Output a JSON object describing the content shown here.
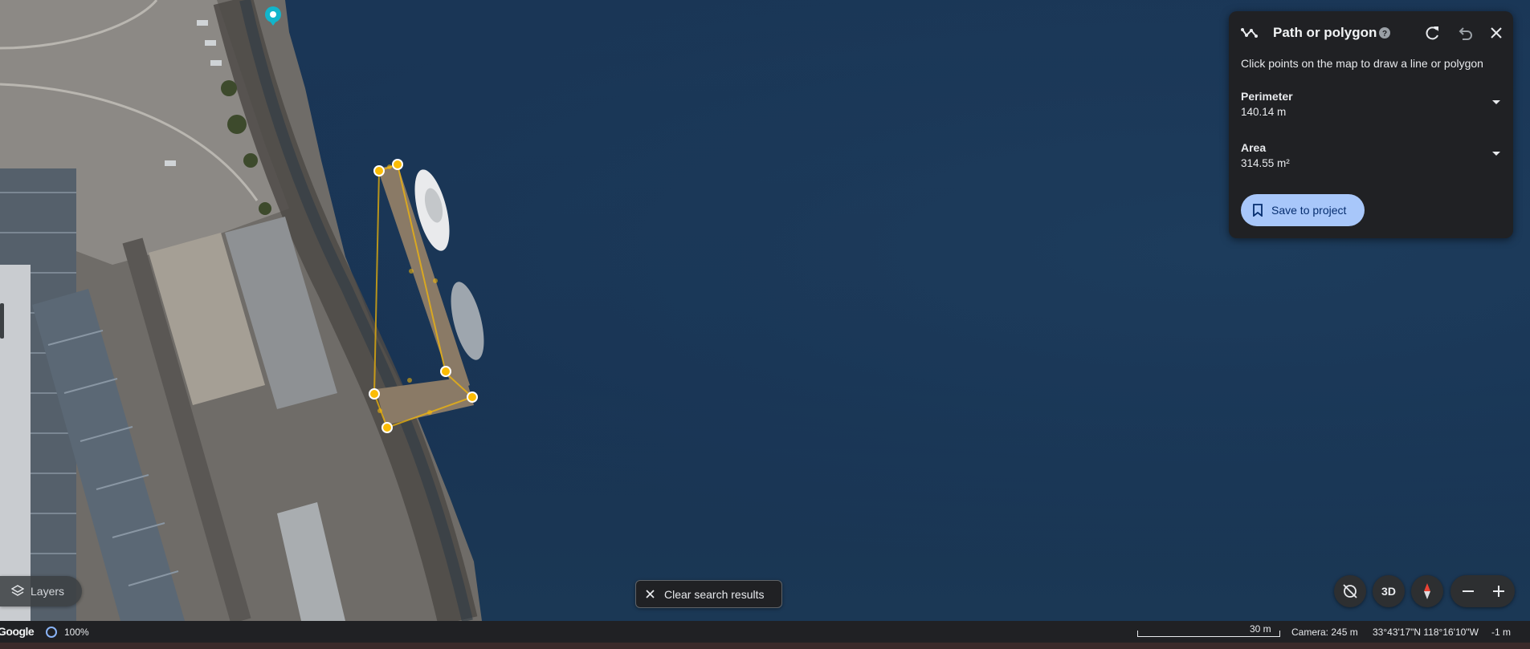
{
  "measure_panel": {
    "title": "Path or polygon",
    "hint": "Click points on the map to draw a line or polygon",
    "perimeter_label": "Perimeter",
    "perimeter_value": "140.14 m",
    "area_label": "Area",
    "area_value": "314.55 m²",
    "save_label": "Save to project",
    "icons": [
      "path-icon",
      "help-icon",
      "redo-icon",
      "undo-icon",
      "close-icon",
      "chevron-down-icon",
      "bookmark-icon"
    ]
  },
  "controls": {
    "layers_label": "Layers",
    "clear_search_label": "Clear search results",
    "three_d_label": "3D",
    "icons": [
      "layers-icon",
      "close-icon",
      "rotate-disable-icon",
      "compass-icon",
      "zoom-out-icon",
      "zoom-in-icon"
    ]
  },
  "status_bar": {
    "logo": "Google",
    "load_percent": "100%",
    "scale": "30 m",
    "camera": "Camera: 245 m",
    "coordinates": "33°43'17\"N 118°16'10\"W",
    "elevation": "-1 m"
  },
  "colors": {
    "water": "#16314f",
    "panel_bg": "#202124",
    "accent_button": "#a8c7fa",
    "vertex": "#fbbc04",
    "location_pin": "#12b5cb"
  }
}
